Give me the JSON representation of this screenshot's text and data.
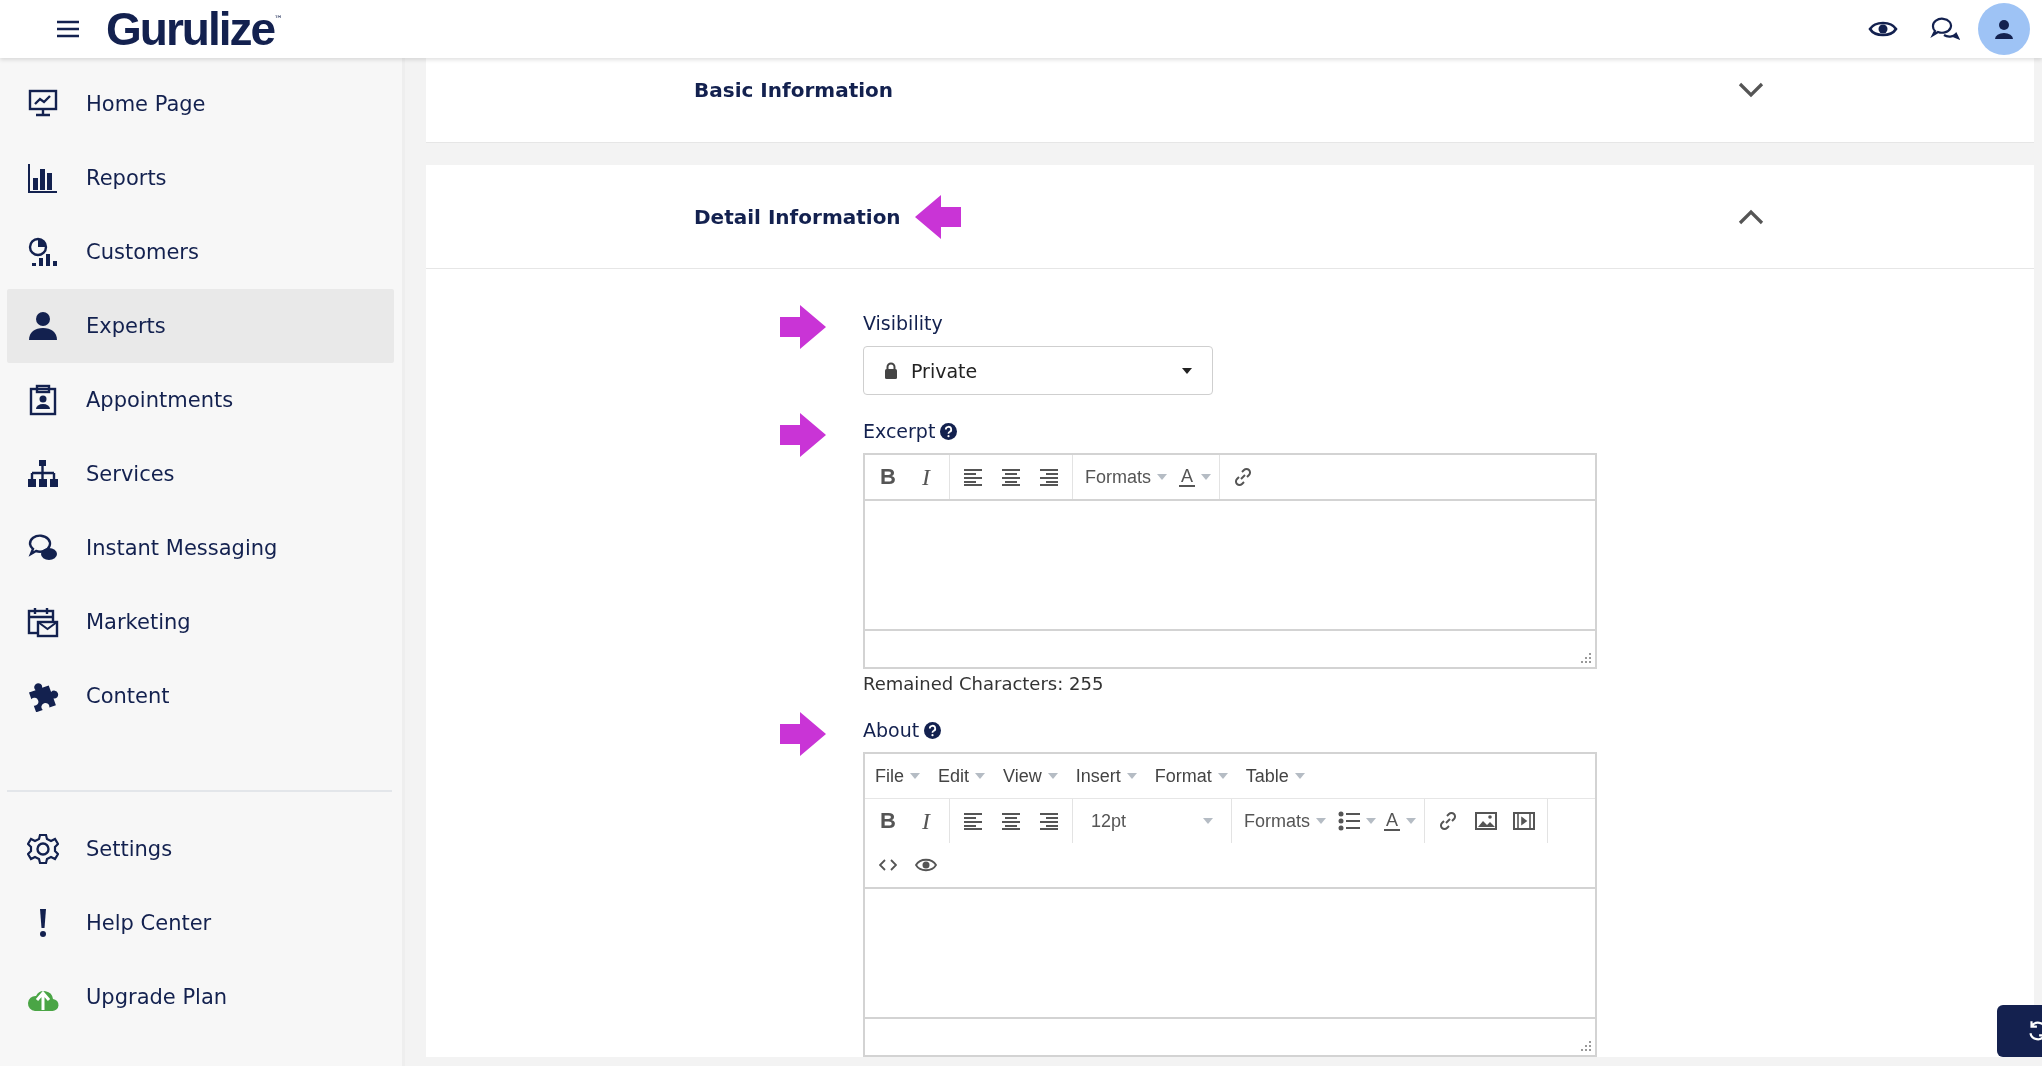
{
  "header": {
    "logo": "Gurulize",
    "logo_mark": "™"
  },
  "sidebar": {
    "items": [
      {
        "label": "Home Page",
        "selected": false
      },
      {
        "label": "Reports",
        "selected": false
      },
      {
        "label": "Customers",
        "selected": false
      },
      {
        "label": "Experts",
        "selected": true
      },
      {
        "label": "Appointments",
        "selected": false
      },
      {
        "label": "Services",
        "selected": false
      },
      {
        "label": "Instant Messaging",
        "selected": false
      },
      {
        "label": "Marketing",
        "selected": false
      },
      {
        "label": "Content",
        "selected": false
      }
    ],
    "bottom_items": [
      {
        "label": "Settings",
        "selected": false
      },
      {
        "label": "Help Center",
        "selected": false
      },
      {
        "label": "Upgrade Plan",
        "selected": false
      }
    ]
  },
  "sections": [
    {
      "title": "Basic Information",
      "expanded": false,
      "highlighted": false
    },
    {
      "title": "Detail Information",
      "expanded": true,
      "highlighted": true
    }
  ],
  "fields": [
    {
      "kind": "select",
      "label": "Visibility",
      "highlighted": true,
      "value": "Private"
    },
    {
      "kind": "editor",
      "label": "Excerpt",
      "help": true,
      "highlighted": true,
      "counter": "Remained Characters: 255",
      "toolbar": [
        [
          [
            {
              "kind": "bold",
              "label": "B"
            },
            {
              "kind": "italic",
              "label": "I"
            }
          ],
          [
            {
              "kind": "align-left"
            },
            {
              "kind": "align-center"
            },
            {
              "kind": "align-right"
            }
          ],
          [
            {
              "kind": "dropdown",
              "label": "Formats"
            },
            {
              "kind": "color",
              "label": "A"
            }
          ],
          [
            {
              "kind": "link"
            }
          ]
        ]
      ]
    },
    {
      "kind": "editor",
      "label": "About",
      "help": true,
      "highlighted": true,
      "menubar": [
        "File",
        "Edit",
        "View",
        "Insert",
        "Format",
        "Table"
      ],
      "toolbar": [
        [
          [
            {
              "kind": "bold",
              "label": "B"
            },
            {
              "kind": "italic",
              "label": "I"
            }
          ],
          [
            {
              "kind": "align-left"
            },
            {
              "kind": "align-center"
            },
            {
              "kind": "align-right"
            }
          ],
          [
            {
              "kind": "size",
              "label": "12pt"
            }
          ],
          [
            {
              "kind": "dropdown",
              "label": "Formats"
            },
            {
              "kind": "list"
            },
            {
              "kind": "color",
              "label": "A"
            }
          ],
          [
            {
              "kind": "link"
            },
            {
              "kind": "image"
            },
            {
              "kind": "media"
            }
          ]
        ],
        [
          [
            {
              "kind": "code"
            },
            {
              "kind": "preview"
            }
          ]
        ]
      ]
    }
  ]
}
